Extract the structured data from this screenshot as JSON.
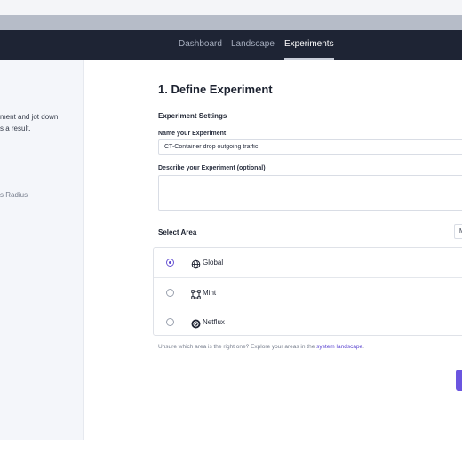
{
  "nav": {
    "items": [
      {
        "label": "Dashboard"
      },
      {
        "label": "Landscape"
      },
      {
        "label": "Experiments"
      }
    ],
    "active": "Experiments"
  },
  "sidebar": {
    "line1": "ment and jot down",
    "line2": "s a result.",
    "line3": "s Radius"
  },
  "main": {
    "title": "1. Define Experiment",
    "settings_heading": "Experiment Settings",
    "name_label": "Name your Experiment",
    "name_value": "CT-Container drop outgoing traffic",
    "describe_label": "Describe your Experiment (optional)",
    "describe_value": "",
    "select_area_heading": "Select Area",
    "select_area_button_fragment": "M",
    "areas": [
      {
        "name": "Global",
        "icon": "globe-icon",
        "selected": true
      },
      {
        "name": "Mint",
        "icon": "frame-icon",
        "selected": false
      },
      {
        "name": "Netflux",
        "icon": "netflux-logo-icon",
        "selected": false
      }
    ],
    "helper_text": "Unsure which area is the right one? Explore your areas in the",
    "helper_link": "system landscape",
    "helper_end": "."
  },
  "colors": {
    "navbar_bg": "#1e2434",
    "accent": "#5b45d0",
    "sidebar_bg": "#f4f6fa"
  }
}
